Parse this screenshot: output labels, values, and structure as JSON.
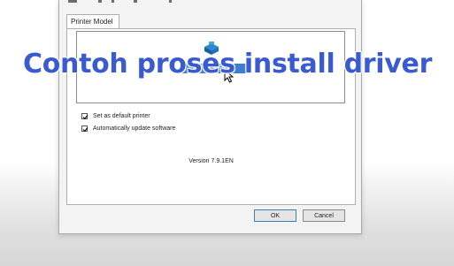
{
  "overlay": {
    "caption": "Contoh proses install driver"
  },
  "dialog": {
    "tab_label": "Printer Model",
    "model_list": {
      "items": [
        "EP  Ol  S  Series"
      ],
      "selected_index": 0,
      "icon": "printer-icon"
    },
    "options": [
      {
        "label": "Set as default printer",
        "checked": true
      },
      {
        "label": "Automatically update software",
        "checked": true
      }
    ],
    "version_text": "Version 7.9.1EN",
    "buttons": {
      "ok_label": "OK",
      "cancel_label": "Cancel"
    }
  },
  "colors": {
    "selection": "#3d7dd4",
    "overlay_text": "#3a5bd0",
    "dialog_bg": "#f3f3f3"
  }
}
